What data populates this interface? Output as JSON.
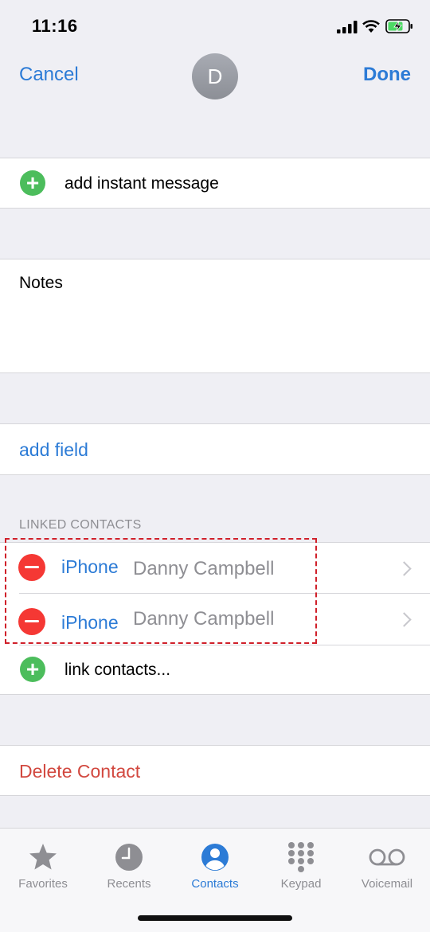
{
  "status": {
    "time": "11:16"
  },
  "nav": {
    "cancel": "Cancel",
    "done": "Done",
    "avatar_initial": "D"
  },
  "rows": {
    "add_instant_message": "add instant message",
    "notes": "Notes",
    "add_field": "add field",
    "linked_contacts_header": "LINKED CONTACTS",
    "linked": [
      {
        "source": "iPhone",
        "name": "Danny Campbell"
      },
      {
        "source": "iPhone",
        "name": "Danny Campbell"
      }
    ],
    "link_contacts": "link contacts...",
    "delete_contact": "Delete Contact"
  },
  "tabs": [
    {
      "label": "Favorites",
      "icon": "star-icon"
    },
    {
      "label": "Recents",
      "icon": "clock-icon"
    },
    {
      "label": "Contacts",
      "icon": "person-circle-icon",
      "active": true
    },
    {
      "label": "Keypad",
      "icon": "keypad-icon"
    },
    {
      "label": "Voicemail",
      "icon": "voicemail-icon"
    }
  ],
  "colors": {
    "accent": "#2c7bd6",
    "destructive": "#d2483f",
    "add": "#4cbd5c",
    "remove": "#f53834",
    "highlight": "#d0202a"
  }
}
